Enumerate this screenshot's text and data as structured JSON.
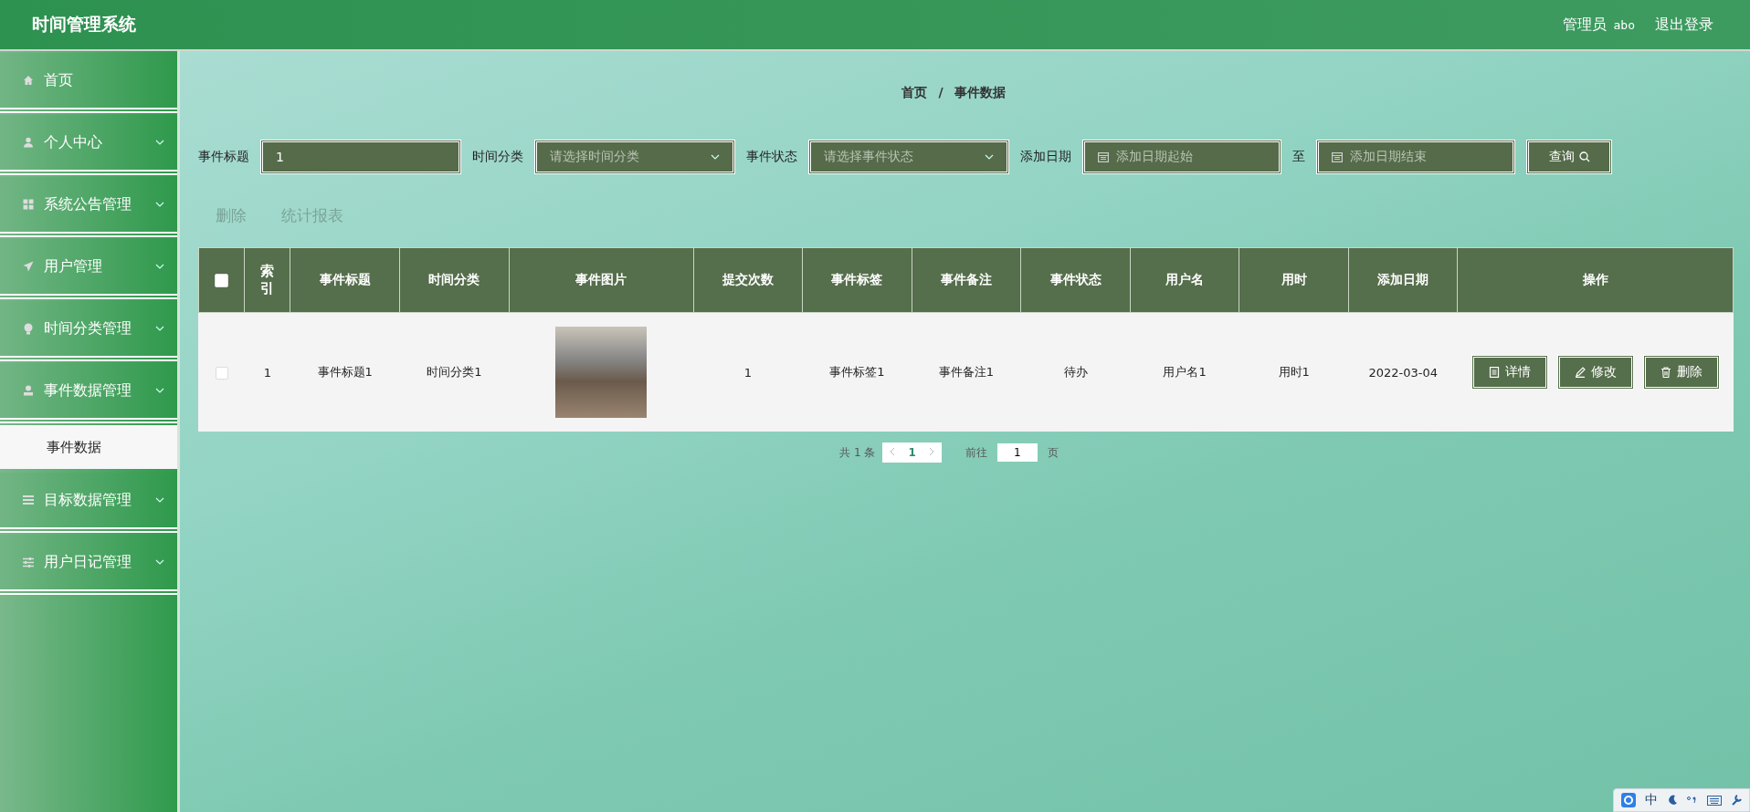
{
  "header": {
    "title": "时间管理系统",
    "user_role": "管理员",
    "user_name": "abo",
    "logout": "退出登录"
  },
  "sidebar": {
    "items": [
      {
        "label": "首页",
        "kind": "link"
      },
      {
        "label": "个人中心",
        "kind": "menu"
      },
      {
        "label": "系统公告管理",
        "kind": "menu"
      },
      {
        "label": "用户管理",
        "kind": "menu"
      },
      {
        "label": "时间分类管理",
        "kind": "menu"
      },
      {
        "label": "事件数据管理",
        "kind": "menu",
        "children": [
          {
            "label": "事件数据",
            "selected": true
          }
        ]
      },
      {
        "label": "目标数据管理",
        "kind": "menu"
      },
      {
        "label": "用户日记管理",
        "kind": "menu"
      }
    ]
  },
  "breadcrumb": {
    "items": [
      "首页",
      "事件数据"
    ],
    "separator": "/"
  },
  "search": {
    "fields": [
      {
        "label": "事件标题",
        "kind": "text",
        "value": "1"
      },
      {
        "label": "时间分类",
        "kind": "select",
        "placeholder": "请选择时间分类"
      },
      {
        "label": "事件状态",
        "kind": "select",
        "placeholder": "请选择事件状态"
      },
      {
        "label": "添加日期",
        "kind": "date",
        "placeholder": "添加日期起始"
      },
      {
        "label": "至",
        "kind": "date",
        "placeholder": "添加日期结束"
      }
    ],
    "button": "查询"
  },
  "actions": [
    "删除",
    "统计报表"
  ],
  "table": {
    "header_checked": false,
    "columns": [
      {
        "label": "索引",
        "kind": "text"
      },
      {
        "label": "事件标题",
        "kind": "text"
      },
      {
        "label": "时间分类",
        "kind": "text"
      },
      {
        "label": "事件图片",
        "kind": "image"
      },
      {
        "label": "提交次数",
        "kind": "text"
      },
      {
        "label": "事件标签",
        "kind": "text"
      },
      {
        "label": "事件备注",
        "kind": "text"
      },
      {
        "label": "事件状态",
        "kind": "text"
      },
      {
        "label": "用户名",
        "kind": "text"
      },
      {
        "label": "用时",
        "kind": "text"
      },
      {
        "label": "添加日期",
        "kind": "text"
      },
      {
        "label": "操作",
        "kind": "actions"
      }
    ],
    "rows": [
      {
        "checked": false,
        "cells": [
          "1",
          "事件标题1",
          "时间分类1",
          null,
          "1",
          "事件标签1",
          "事件备注1",
          "待办",
          "用户名1",
          "用时1",
          "2022-03-04",
          [
            "详情",
            "修改",
            "删除"
          ]
        ]
      }
    ]
  },
  "pagination": {
    "total": "共 1 条",
    "pages": [
      {
        "label": "1",
        "selected": true
      }
    ],
    "goto_label": "前往",
    "goto_value": "1",
    "goto_suffix": "页"
  },
  "ime_bar": {
    "mode": "中"
  }
}
